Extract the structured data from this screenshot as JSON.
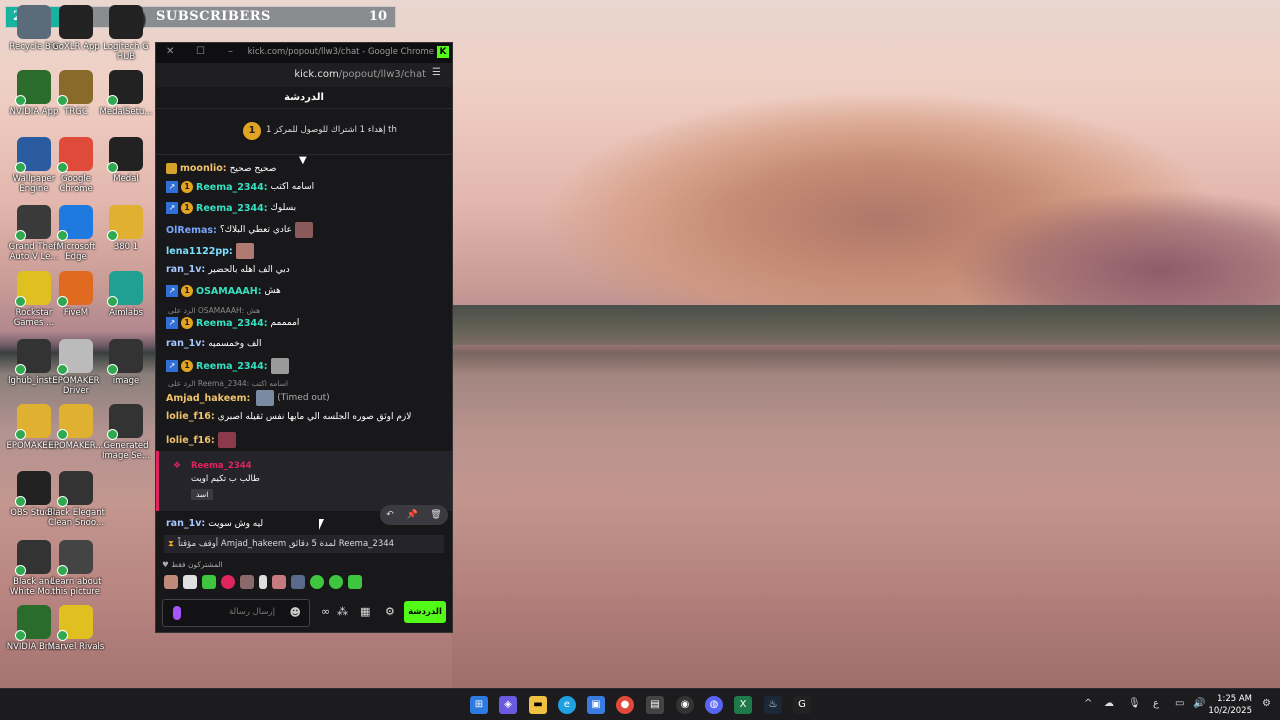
{
  "overlay": {
    "count": "2",
    "logo": "G",
    "title": "SUBSCRIBERS",
    "goal": "10"
  },
  "desktop": {
    "icons": [
      {
        "label": "Recycle Bin"
      },
      {
        "label": "GoXLR App"
      },
      {
        "label": "Logitech G HUB"
      },
      {
        "label": "NVIDIA App"
      },
      {
        "label": "TRGC"
      },
      {
        "label": "MedalSetu..."
      },
      {
        "label": "Wallpaper Engine"
      },
      {
        "label": "Google Chrome"
      },
      {
        "label": "Medal"
      },
      {
        "label": "Grand Theft Auto V Le..."
      },
      {
        "label": "Microsoft Edge"
      },
      {
        "label": "380 1"
      },
      {
        "label": "Rockstar Games ..."
      },
      {
        "label": "FiveM"
      },
      {
        "label": "Aimlabs"
      },
      {
        "label": "lghub_inst..."
      },
      {
        "label": "EPOMAKER Driver"
      },
      {
        "label": "image"
      },
      {
        "label": "EPOMAKER..."
      },
      {
        "label": "EPOMAKER..."
      },
      {
        "label": "Generated Image Se..."
      },
      {
        "label": "OBS Studio"
      },
      {
        "label": "Black Elegant Clean Snoo..."
      },
      {
        "label": "Black and White Mo..."
      },
      {
        "label": "Learn about this picture"
      },
      {
        "label": "NVIDIA Bro..."
      },
      {
        "label": "Marvel Rivals"
      }
    ]
  },
  "chrome": {
    "title": "kick.com/popout/llw3/chat - Google Chrome",
    "url_host": "kick.com",
    "url_path": "/popout/llw3/chat"
  },
  "chat": {
    "header": "الدردشة",
    "pinned_rank": "1",
    "pinned_text": "إهداء 1 اشتراك للوصول للمركز 1 th",
    "messages": [
      {
        "user": "moonlio:",
        "text": "صحيح صحيح"
      },
      {
        "user": "Reema_2344:",
        "text": "اسامه اكتب"
      },
      {
        "user": "Reema_2344:",
        "text": "بسلوك"
      },
      {
        "user": "OlRemas:",
        "text": "عادي تعطي البلاك؟"
      },
      {
        "user": "lena1122pp:",
        "text": ""
      },
      {
        "user": "ran_1v:",
        "text": "دبي الف اهله بالحضير"
      },
      {
        "user": "OSAMAAAH:",
        "text": "هش"
      },
      {
        "user": "Reema_2344:",
        "text": "اممممم"
      },
      {
        "user": "ran_1v:",
        "text": "الف وخمسميه"
      },
      {
        "user": "Reema_2344:",
        "text": ""
      },
      {
        "user": "Amjad_hakeem:",
        "text": "(Timed out)"
      },
      {
        "user": "lolie_f16:",
        "text": "لازم اوثق صوره الجلسه الي مابها نفس ثقيله اصبري"
      },
      {
        "user": "lolie_f16:",
        "text": ""
      }
    ],
    "reply1": "الرد على OSAMAAAH: هش",
    "reply2": "الرد على Reema_2344: اسامه اكتب",
    "highlight": {
      "user": "Reema_2344",
      "text": "طالب ب تكيم اويت",
      "badge": "اسد"
    },
    "last_msg": {
      "user": "ran_1v:",
      "text": "ليه وش سويت"
    },
    "timeout_text": "أوقف مؤقتاً Amjad_hakeem لمدة 5 دقائق Reema_2344",
    "subs_only": "المشتركون فقط",
    "input_placeholder": "إرسال رسالة",
    "send_label": "الدردشة"
  },
  "taskbar": {
    "time": "1:25 AM",
    "date": "10/2/2025",
    "lang": "ع"
  }
}
